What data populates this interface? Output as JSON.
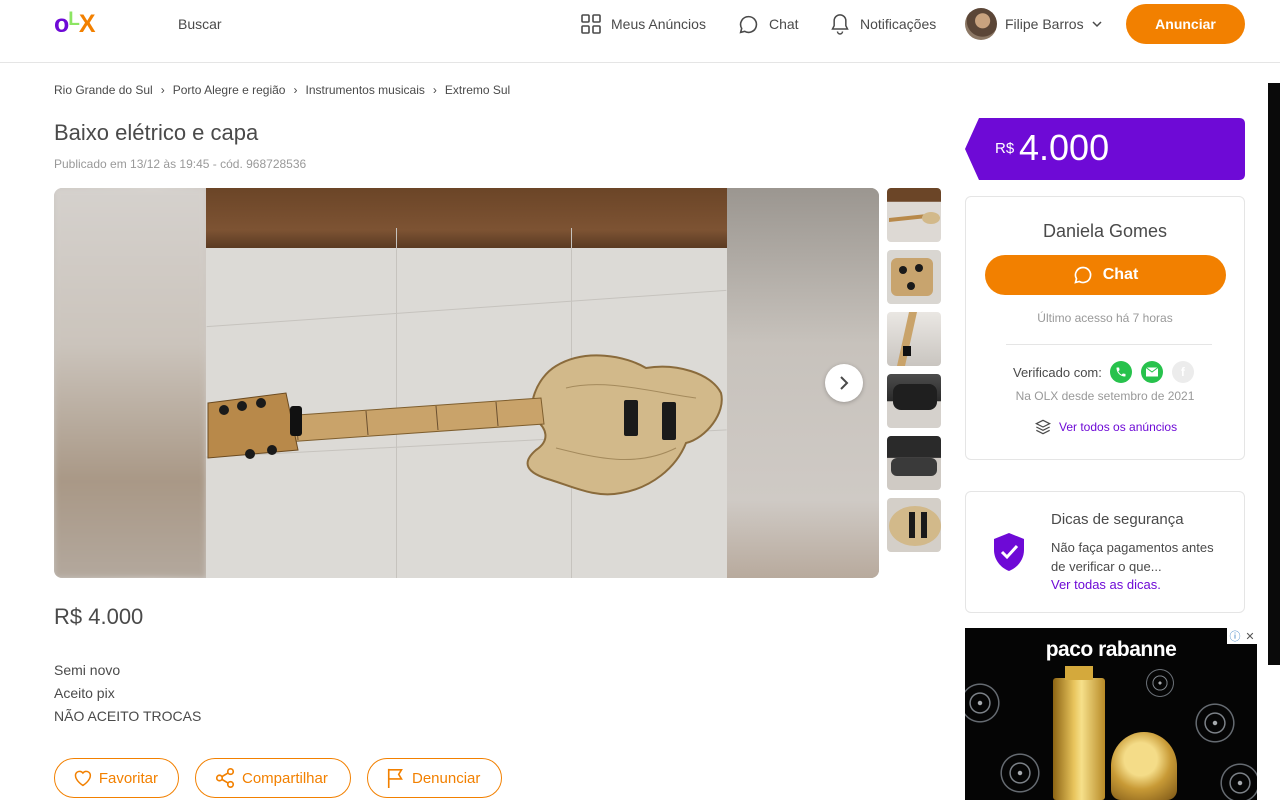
{
  "header": {
    "logo": "OLX",
    "search_label": "Buscar",
    "my_ads_label": "Meus Anúncios",
    "chat_label": "Chat",
    "notifications_label": "Notificações",
    "user_name": "Filipe Barros",
    "post_ad_label": "Anunciar"
  },
  "breadcrumb": [
    "Rio Grande do Sul",
    "Porto Alegre e região",
    "Instrumentos musicais",
    "Extremo Sul"
  ],
  "listing": {
    "title": "Baixo elétrico e capa",
    "meta": "Publicado em 13/12 às 19:45 - cód. 968728536",
    "price": "R$ 4.000",
    "description": [
      "Semi novo",
      "Aceito pix",
      "NÃO ACEITO TROCAS"
    ],
    "gallery": {
      "thumbnail_count": 6
    }
  },
  "actions": {
    "favorite": "Favoritar",
    "share": "Compartilhar",
    "report": "Denunciar"
  },
  "price_flag": {
    "currency": "R$",
    "value": "4.000"
  },
  "seller": {
    "name": "Daniela Gomes",
    "chat_label": "Chat",
    "last_access": "Último acesso há 7 horas",
    "verified_label": "Verificado com:",
    "verified_icons": [
      "phone-icon",
      "email-icon",
      "facebook-icon"
    ],
    "since": "Na OLX desde setembro de 2021",
    "see_all": "Ver todos os anúncios"
  },
  "safety": {
    "title": "Dicas de segurança",
    "text": "Não faça pagamentos antes de verificar o que...",
    "link": "Ver todas as dicas."
  },
  "ad": {
    "brand": "paco rabanne"
  },
  "colors": {
    "brand_purple": "#6e0ad6",
    "brand_orange": "#f28000",
    "verified_green": "#27c24c"
  }
}
